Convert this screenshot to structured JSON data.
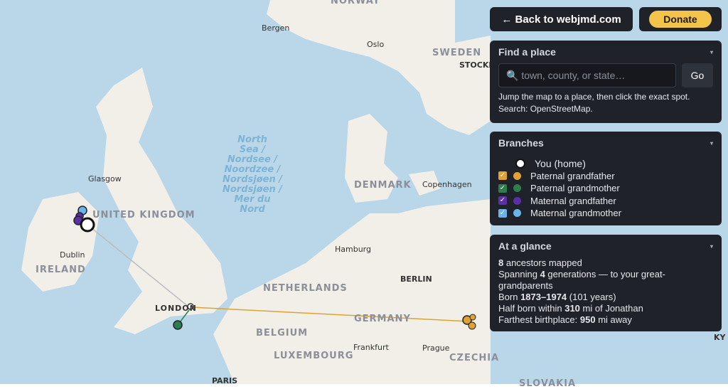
{
  "map": {
    "countries": {
      "norway": "NORWAY",
      "sweden": "SWEDEN",
      "uk": "UNITED KINGDOM",
      "ireland": "IRELAND",
      "denmark": "DENMARK",
      "netherlands": "NETHERLANDS",
      "belgium": "BELGIUM",
      "germany": "GERMANY",
      "luxembourg": "LUXEMBOURG",
      "czechia": "CZECHIA",
      "slovakia": "SLOVAKIA",
      "london": "LONDON"
    },
    "cities": {
      "bergen": "Bergen",
      "oslo": "Oslo",
      "stockholm": "STOCKH",
      "glasgow": "Glasgow",
      "dublin": "Dublin",
      "copenhagen": "Copenhagen",
      "hamburg": "Hamburg",
      "berlin": "BERLIN",
      "frankfurt": "Frankfurt",
      "prague": "Prague",
      "paris": "PARIS",
      "kyiv": "KY"
    },
    "sea": [
      "North",
      "Sea /",
      "Nordsee /",
      "Noordzee /",
      "Nordsjøen /",
      "Nordsjøen /",
      "Mer du",
      "Nord"
    ],
    "colors": {
      "water": "#b9d7e8",
      "land": "#f2efe9",
      "paternal_grandfather": "#e0a232",
      "paternal_grandmother": "#2e7d4f",
      "maternal_grandfather": "#5b2fa8",
      "maternal_grandmother": "#6ab4ea",
      "home": "#ffffff"
    }
  },
  "nav": {
    "back_label": "← Back to webjmd.com",
    "donate_label": "Donate"
  },
  "find": {
    "title": "Find a place",
    "placeholder": "🔍 town, county, or state…",
    "go_label": "Go",
    "help": "Jump the map to a place, then click the exact spot.",
    "source": "Search: OpenStreetMap."
  },
  "branches": {
    "title": "Branches",
    "home_label": "You (home)",
    "items": [
      {
        "label": "Paternal grandfather",
        "color": "#e0a232"
      },
      {
        "label": "Paternal grandmother",
        "color": "#2e7d4f"
      },
      {
        "label": "Maternal grandfather",
        "color": "#5b2fa8"
      },
      {
        "label": "Maternal grandmother",
        "color": "#6ab4ea"
      }
    ]
  },
  "glance": {
    "title": "At a glance",
    "line1_b": "8",
    "line1": " ancestors mapped",
    "line2a": "Spanning ",
    "line2_b": "4",
    "line2c": " generations — to your great-grandparents",
    "line3a": "Born ",
    "line3_b": "1873–1974",
    "line3c": " (101 years)",
    "line4a": "Half born within ",
    "line4_b": "310",
    "line4c": " mi of Jonathan",
    "line5a": "Farthest birthplace: ",
    "line5_b": "950",
    "line5c": " mi away"
  }
}
